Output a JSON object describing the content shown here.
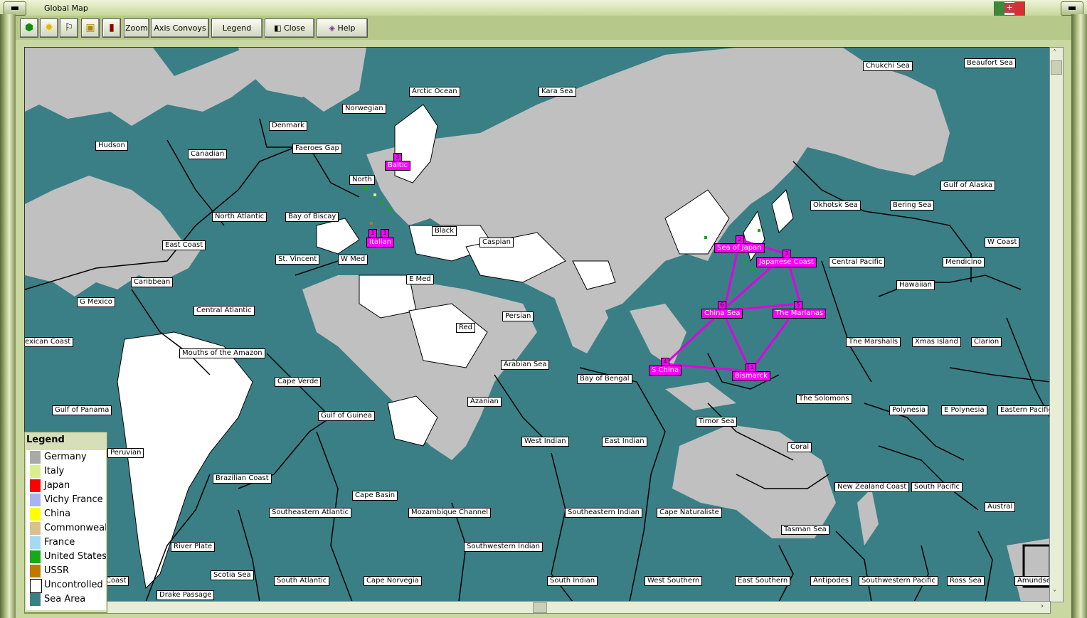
{
  "window": {
    "title": "Global Map"
  },
  "toolbar": {
    "zoom": "Zoom",
    "axis_convoys": "Axis Convoys",
    "legend": "Legend",
    "close": "Close",
    "help": "Help"
  },
  "legend": {
    "title": "Legend",
    "items": [
      {
        "label": "Germany",
        "color": "#a9a9a9"
      },
      {
        "label": "Italy",
        "color": "#d8f08a"
      },
      {
        "label": "Japan",
        "color": "#ff0000"
      },
      {
        "label": "Vichy France",
        "color": "#a8b4f0"
      },
      {
        "label": "China",
        "color": "#ffff00"
      },
      {
        "label": "Commonwealth",
        "color": "#d8c090"
      },
      {
        "label": "France",
        "color": "#a8d8f0"
      },
      {
        "label": "United States",
        "color": "#18a818"
      },
      {
        "label": "USSR",
        "color": "#c07800"
      },
      {
        "label": "Uncontrolled",
        "color": "#ffffff"
      },
      {
        "label": "Sea Area",
        "color": "#3a7f86"
      }
    ]
  },
  "sea_labels": [
    "Chukchi Sea",
    "Beaufort Sea",
    "Arctic Ocean",
    "Kara Sea",
    "Norwegian",
    "Denmark",
    "Hudson",
    "Canadian",
    "Faeroes Gap",
    "North",
    "Gulf of Alaska",
    "Okhotsk Sea",
    "Bering Sea",
    "North Atlantic",
    "Bay of Biscay",
    "Black",
    "East Coast",
    "Caspian",
    "W Coast",
    "Central Pacific",
    "Mendicino",
    "St. Vincent",
    "W Med",
    "Caribbean",
    "E Med",
    "Hawaiian",
    "G Mexico",
    "Central Atlantic",
    "Persian",
    "Red",
    "exican Coast",
    "Mouths of the Amazon",
    "The Marshalls",
    "Xmas Island",
    "Clarion",
    "Arabian Sea",
    "Bay of Bengal",
    "Cape Verde",
    "Azanian",
    "The Solomons",
    "Gulf of Panama",
    "Gulf of Guinea",
    "Polynesia",
    "E Polynesia",
    "Eastern Pacific",
    "Timor Sea",
    "West Indian",
    "East Indian",
    "Peruvian",
    "Coral",
    "Brazilian Coast",
    "New Zealand Coast",
    "South Pacific",
    "Cape Basin",
    "Austral",
    "Southeastern Atlantic",
    "Mozambique Channel",
    "Southeastern Indian",
    "Cape Naturaliste",
    "Tasman Sea",
    "Southwestern Indian",
    "River Plate",
    "Scotia Sea",
    "South Atlantic",
    "Cape Norvegia",
    "South Indian",
    "West Southern",
    "East Southern",
    "Antipodes",
    "Southwestern Pacific",
    "Ross Sea",
    "Amundse",
    "Drake Passage",
    "Coast"
  ],
  "convoy_labels": [
    "Baltic",
    "Italian",
    "Sea of Japan",
    "Japanese Coast",
    "China Sea",
    "The Marianas",
    "S China",
    "Bismarck"
  ],
  "convoy_numbers": [
    "3",
    "1",
    "1",
    "2",
    "3",
    "5",
    "6",
    "1",
    "4",
    "1"
  ]
}
